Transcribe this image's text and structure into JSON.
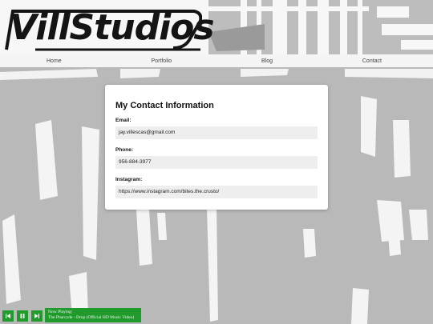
{
  "header": {
    "logo_text": "VillStudios"
  },
  "nav": {
    "items": [
      {
        "label": "Home"
      },
      {
        "label": "Portfolio"
      },
      {
        "label": "Blog"
      },
      {
        "label": "Contact"
      }
    ]
  },
  "contact": {
    "title": "My Contact Information",
    "email_label": "Email:",
    "email_value": "jay.villescas@gmail.com",
    "phone_label": "Phone:",
    "phone_value": "956-884-3977",
    "instagram_label": "Instagram:",
    "instagram_value": "https://www.instagram.com/bites.the.crusto/"
  },
  "player": {
    "prev_icon": "skip-back-icon",
    "pause_icon": "pause-icon",
    "next_icon": "skip-forward-icon",
    "now_playing_label": "Now Playing:",
    "track": "The Pharcyde - Drop (Official HD Music Video)",
    "accent_color": "#1f9a2b"
  },
  "colors": {
    "background_gray": "#b7b7b7",
    "nav_bg": "#f4f4f4"
  }
}
